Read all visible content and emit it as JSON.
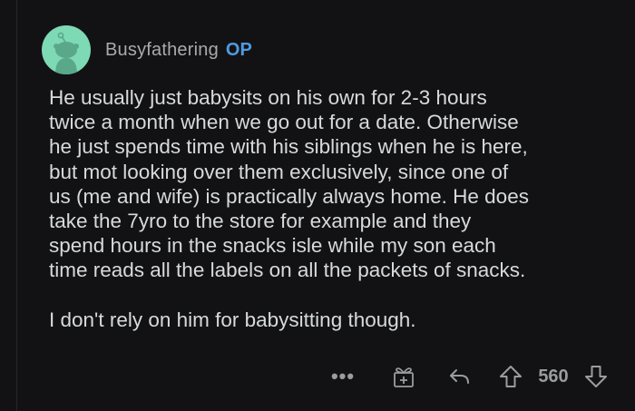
{
  "comment": {
    "author": "Busyfathering",
    "badge": "OP",
    "avatar_color": "#7ed9b5",
    "paragraph1_lines": [
      "He usually just babysits on his own for 2-3 hours",
      "twice a month when we go out for a date. Otherwise",
      "he just spends time with his siblings when he is here,",
      "but mot looking over them exclusively, since one of",
      "us (me and wife) is practically always home. He does",
      "take the 7yro to the store for example and they",
      "spend hours in the snacks isle while my son each",
      "time reads all the labels on all the packets of snacks."
    ],
    "paragraph2": "I don't rely on him for babysitting though."
  },
  "actions": {
    "more_label": "•••",
    "score": "560",
    "icons": [
      "more-icon",
      "award-icon",
      "reply-icon",
      "upvote-icon",
      "downvote-icon"
    ]
  },
  "colors": {
    "background": "#121214",
    "text": "#d7dadc",
    "muted": "#a8aaab",
    "op_blue": "#4f9be0"
  }
}
